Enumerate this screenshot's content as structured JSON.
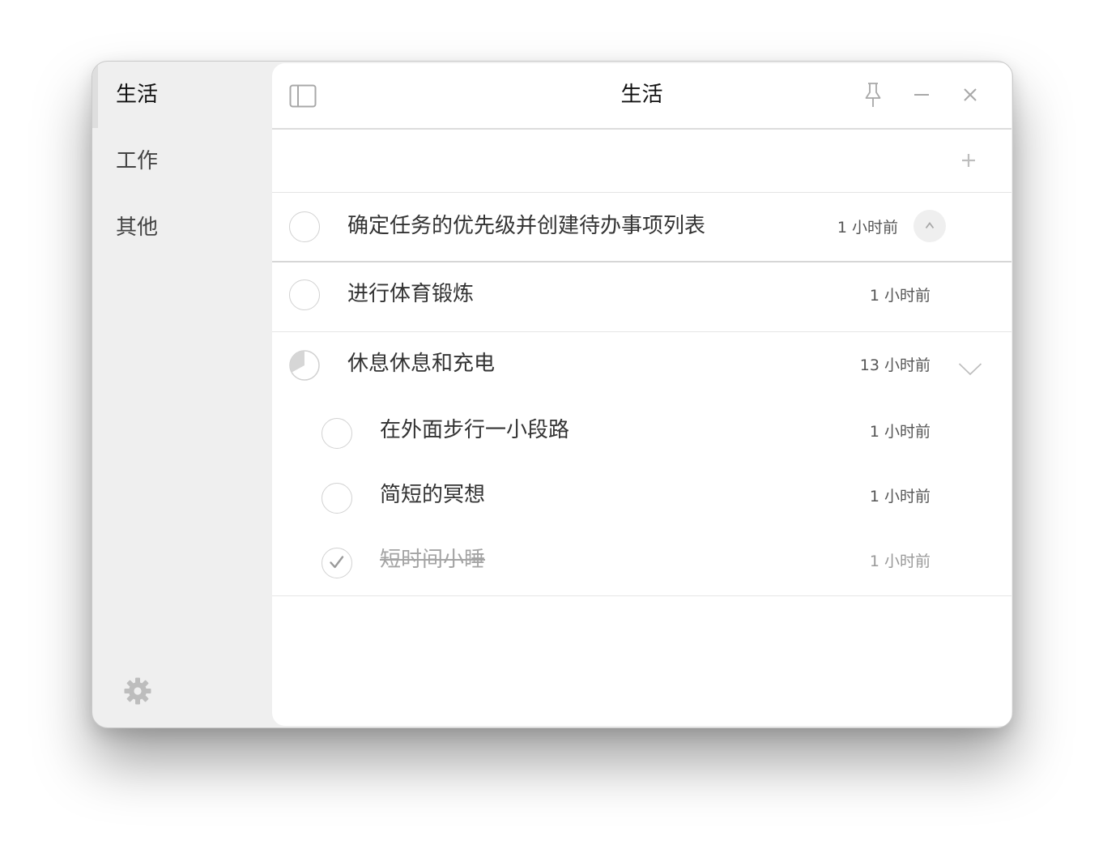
{
  "sidebar": {
    "items": [
      {
        "label": "生活",
        "active": true
      },
      {
        "label": "工作",
        "active": false
      },
      {
        "label": "其他",
        "active": false
      }
    ],
    "settings_icon": "gear-icon"
  },
  "header": {
    "title": "生活",
    "icons": [
      "sidebar-toggle-icon",
      "pin-icon",
      "minimize-icon",
      "close-icon"
    ]
  },
  "addbar": {
    "icon": "plus-icon"
  },
  "tasks": [
    {
      "text": "确定任务的优先级并创建待办事项列表",
      "time": "1 小时前",
      "status": "open",
      "control": "collapse-up"
    },
    {
      "text": "进行体育锻炼",
      "time": "1 小时前",
      "status": "open"
    },
    {
      "text": "休息休息和充电",
      "time": "13 小时前",
      "status": "partial",
      "progress": 0.33,
      "control": "expand-down",
      "subtasks": [
        {
          "text": "在外面步行一小段路",
          "time": "1 小时前",
          "status": "open"
        },
        {
          "text": "简短的冥想",
          "time": "1 小时前",
          "status": "open"
        },
        {
          "text": "短时间小睡",
          "time": "1 小时前",
          "status": "done"
        }
      ]
    }
  ],
  "colors": {
    "sidebar_bg": "#efefef",
    "panel_bg": "#ffffff",
    "divider": "#e4e4e4",
    "icon_gray": "#b8b8b8",
    "text_dark": "#333333",
    "text_done": "#a4a4a4"
  }
}
